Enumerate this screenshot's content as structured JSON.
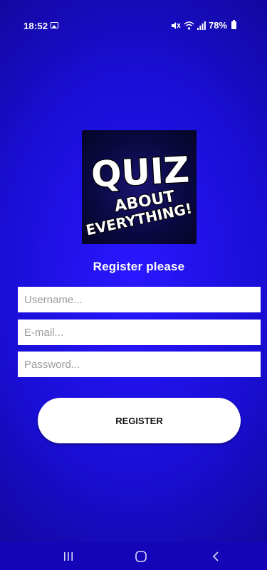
{
  "status_bar": {
    "time": "18:52",
    "battery": "78%",
    "icons": [
      "gallery-icon",
      "mute-icon",
      "wifi-icon",
      "signal-icon",
      "battery-icon"
    ]
  },
  "logo": {
    "line1": "QUIZ",
    "line2": "ABOUT",
    "line3": "EVERYTHING!"
  },
  "form": {
    "title": "Register please",
    "username_placeholder": "Username...",
    "email_placeholder": "E-mail...",
    "password_placeholder": "Password...",
    "submit_label": "REGISTER"
  },
  "nav": {
    "icons": [
      "recent-apps-icon",
      "home-icon",
      "back-icon"
    ]
  },
  "colors": {
    "background": "#1a0fd8",
    "accent": "#ffffff",
    "nav_bar": "#1405b8"
  }
}
